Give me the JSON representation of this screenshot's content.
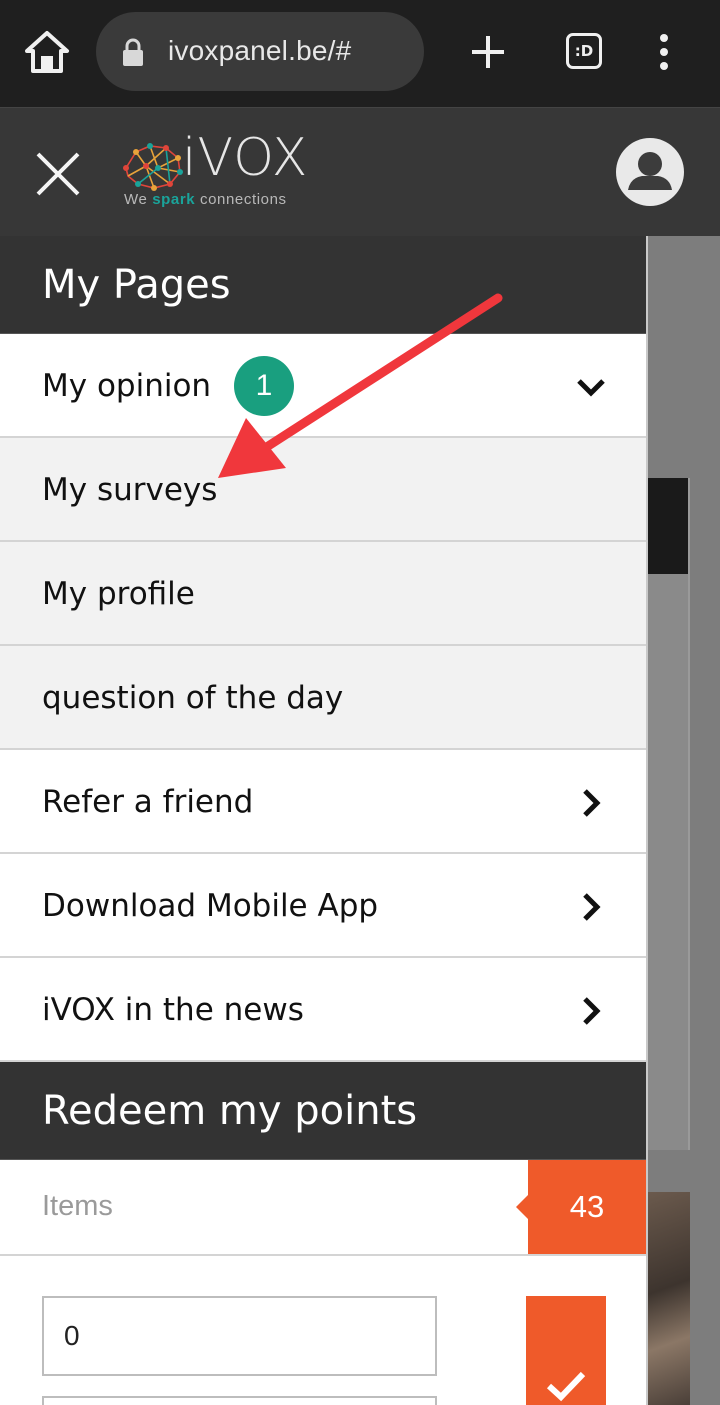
{
  "browser": {
    "url": "ivoxpanel.be/#",
    "tab_switcher_label": ":D",
    "icons": [
      "home-icon",
      "lock-icon",
      "new-tab-icon",
      "tab-switcher-icon",
      "menu-icon"
    ]
  },
  "header": {
    "logo_word": "iVOX",
    "tagline_pre": "We ",
    "tagline_spark": "spark",
    "tagline_post": " connections",
    "icons": [
      "close-icon",
      "user-avatar-icon"
    ]
  },
  "my_pages": {
    "title": "My Pages",
    "items": [
      {
        "label": "My opinion",
        "badge": "1",
        "expanded": true
      },
      {
        "label": "My surveys",
        "sub": true
      },
      {
        "label": "My profile",
        "sub": true
      },
      {
        "label": "question of the day",
        "sub": true
      },
      {
        "label": "Refer a friend"
      },
      {
        "label": "Download Mobile App"
      },
      {
        "label": "iVOX in the news"
      }
    ]
  },
  "redeem": {
    "title": "Redeem my points",
    "items_label": "Items",
    "items_count": "43",
    "quantity_value": "0"
  },
  "colors": {
    "accent": "#ef5a2a",
    "badge": "#199f7f",
    "header_bg": "#373737",
    "annotation": "#f0373c"
  }
}
